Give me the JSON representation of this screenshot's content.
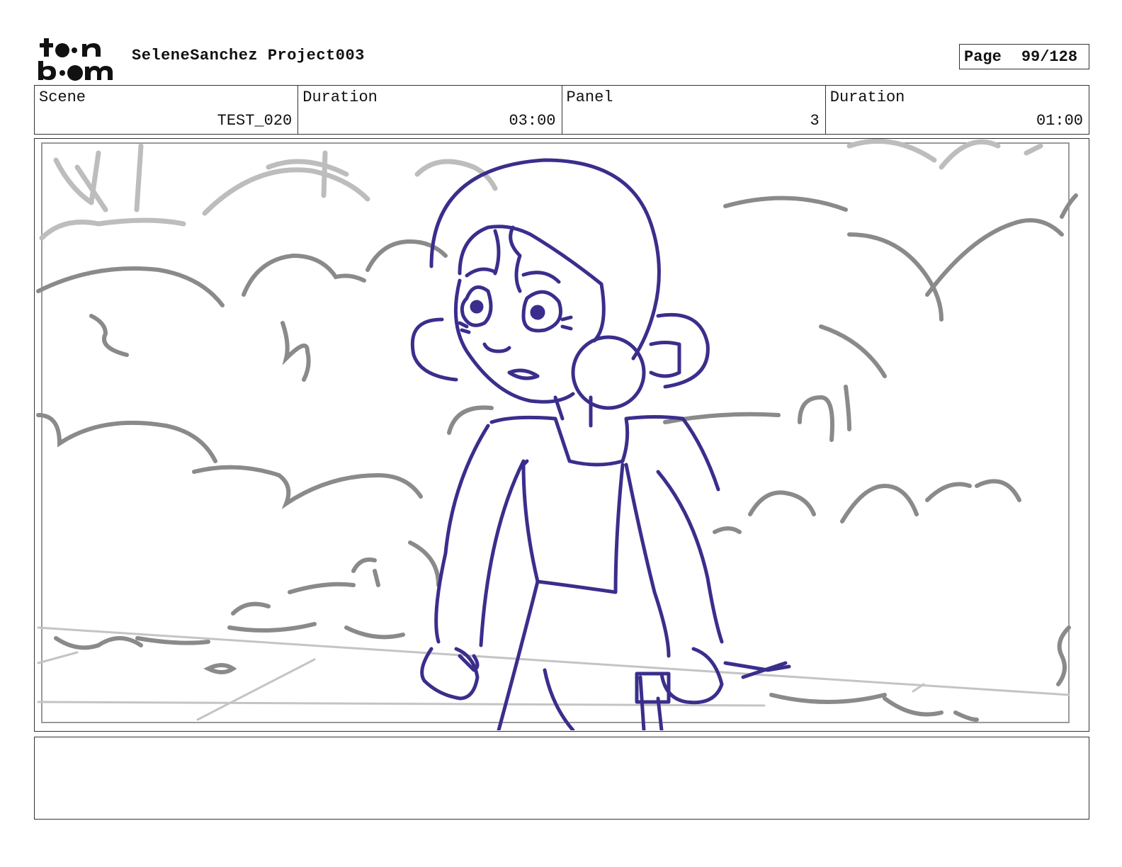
{
  "header": {
    "logo_text_top": "toon",
    "logo_text_bottom": "boom",
    "project_title": "SeleneSanchez Project003",
    "page_label": "Page",
    "page_number": "99/128"
  },
  "info": {
    "scene_label": "Scene",
    "scene_value": "TEST_020",
    "scene_duration_label": "Duration",
    "scene_duration_value": "03:00",
    "panel_label": "Panel",
    "panel_value": "3",
    "panel_duration_label": "Duration",
    "panel_duration_value": "01:00"
  },
  "panel": {
    "sketch_color": "#3a2e8c",
    "background_stroke_color": "#8a8a8a"
  },
  "notes": {
    "text": ""
  }
}
